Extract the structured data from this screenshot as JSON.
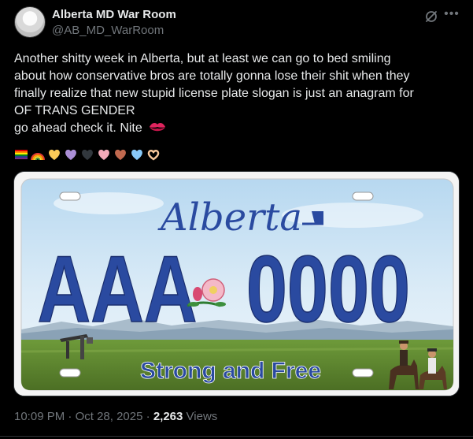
{
  "author": {
    "display_name": "Alberta MD War Room",
    "handle": "@AB_MD_WarRoom"
  },
  "tweet": {
    "lines": [
      "Another shitty week in Alberta, but at least we can go to bed smiling",
      "about how conservative bros are totally gonna lose their shit when they",
      "finally realize that new stupid license plate slogan is just an anagram for",
      "OF TRANS GENDER",
      "go ahead check it. Nite"
    ],
    "trailing_emoji": "kiss-mark",
    "emoji_row": [
      "rainbow-flag",
      "rainbow",
      "yellow-heart",
      "purple-heart",
      "black-heart",
      "pink-heart",
      "brown-heart",
      "light-blue-heart",
      "heart-hands"
    ]
  },
  "plate": {
    "province": "Alberta",
    "letters": "AAA",
    "numbers": "0000",
    "slogan": "Strong and Free"
  },
  "meta": {
    "time": "10:09 PM",
    "separator": "·",
    "date": "Oct 28, 2025",
    "views_count": "2,263",
    "views_label": "Views"
  },
  "colors": {
    "background": "#000000",
    "text": "#e7e9ea",
    "muted": "#71767b",
    "plate_blue": "#2a4aa0",
    "kiss_red": "#e0245e"
  }
}
